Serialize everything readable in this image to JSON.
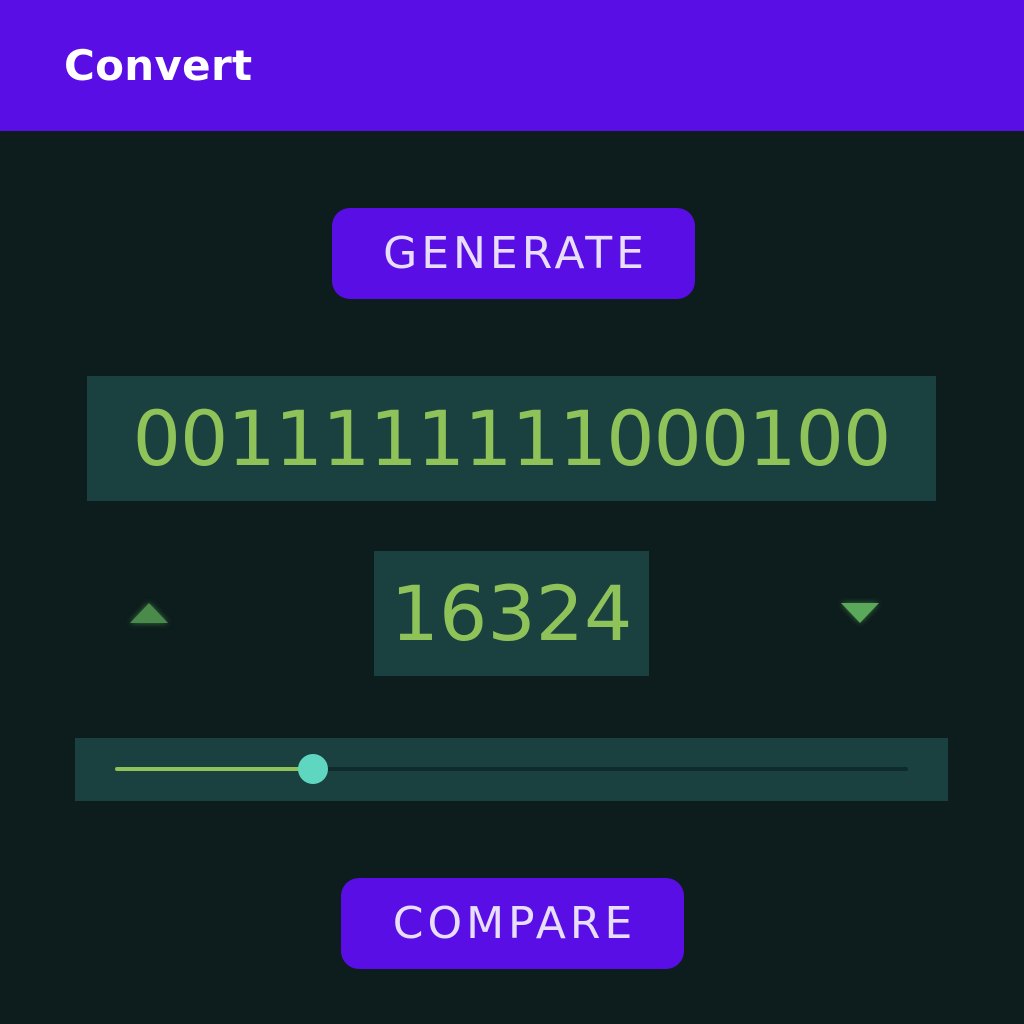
{
  "app_bar": {
    "title": "Convert",
    "color": "#5a0ee6"
  },
  "generate_button": {
    "label": "GENERATE"
  },
  "binary_display": {
    "value": "0011111111000100"
  },
  "decimal_display": {
    "value": "16324"
  },
  "stepper": {
    "up_icon": "triangle-up-icon",
    "down_icon": "triangle-down-icon"
  },
  "slider": {
    "fraction": 0.25
  },
  "compare_button": {
    "label": "COMPARE"
  },
  "colors": {
    "background": "#0d1d1d",
    "panel": "#1b4040",
    "text_green": "#8fc35a",
    "thumb": "#5fd6c0",
    "button": "#5a0ee6"
  }
}
